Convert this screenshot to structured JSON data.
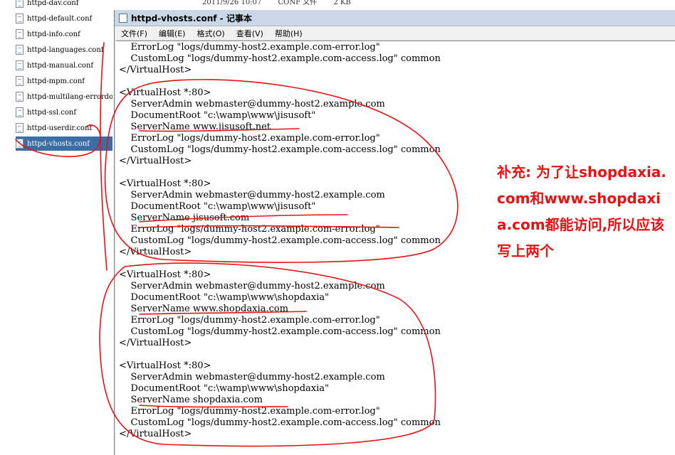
{
  "explorer": {
    "top_row": {
      "date": "2011/9/26 10:07",
      "type": "CONF 文件",
      "size": "2 KB"
    },
    "files": [
      "httpd-dav.conf",
      "httpd-default.conf",
      "httpd-info.conf",
      "httpd-languages.conf",
      "httpd-manual.conf",
      "httpd-mpm.conf",
      "httpd-multilang-errordoc.conf",
      "httpd-ssl.conf",
      "httpd-userdir.conf",
      "httpd-vhosts.conf"
    ],
    "selected_index": 9
  },
  "notepad": {
    "title": "httpd-vhosts.conf - 记事本",
    "menu": [
      "文件(F)",
      "编辑(E)",
      "格式(O)",
      "查看(V)",
      "帮助(H)"
    ],
    "lines": [
      "    ErrorLog \"logs/dummy-host2.example.com-error.log\"",
      "    CustomLog \"logs/dummy-host2.example.com-access.log\" common",
      "</VirtualHost>",
      "",
      "<VirtualHost *:80>",
      "    ServerAdmin webmaster@dummy-host2.example.com",
      "    DocumentRoot \"c:\\wamp\\www\\jisusoft\"",
      "    ServerName www.jisusoft.net",
      "    ErrorLog \"logs/dummy-host2.example.com-error.log\"",
      "    CustomLog \"logs/dummy-host2.example.com-access.log\" common",
      "</VirtualHost>",
      "",
      "<VirtualHost *:80>",
      "    ServerAdmin webmaster@dummy-host2.example.com",
      "    DocumentRoot \"c:\\wamp\\www\\jisusoft\"",
      "    ServerName jisusoft.com",
      "    ErrorLog \"logs/dummy-host2.example.com-error.log\"",
      "    CustomLog \"logs/dummy-host2.example.com-access.log\" common",
      "</VirtualHost>",
      "",
      "<VirtualHost *:80>",
      "    ServerAdmin webmaster@dummy-host2.example.com",
      "    DocumentRoot \"c:\\wamp\\www\\shopdaxia\"",
      "    ServerName www.shopdaxia.com",
      "    ErrorLog \"logs/dummy-host2.example.com-error.log\"",
      "    CustomLog \"logs/dummy-host2.example.com-access.log\" common",
      "</VirtualHost>",
      "",
      "<VirtualHost *:80>",
      "    ServerAdmin webmaster@dummy-host2.example.com",
      "    DocumentRoot \"c:\\wamp\\www\\shopdaxia\"",
      "    ServerName shopdaxia.com",
      "    ErrorLog \"logs/dummy-host2.example.com-error.log\"",
      "    CustomLog \"logs/dummy-host2.example.com-access.log\" common",
      "</VirtualHost>"
    ]
  },
  "annotation": {
    "text": "补充: 为了让shopdaxia.com和www.shopdaxia.com都能访问,所以应该写上两个",
    "color": "#e51414"
  }
}
